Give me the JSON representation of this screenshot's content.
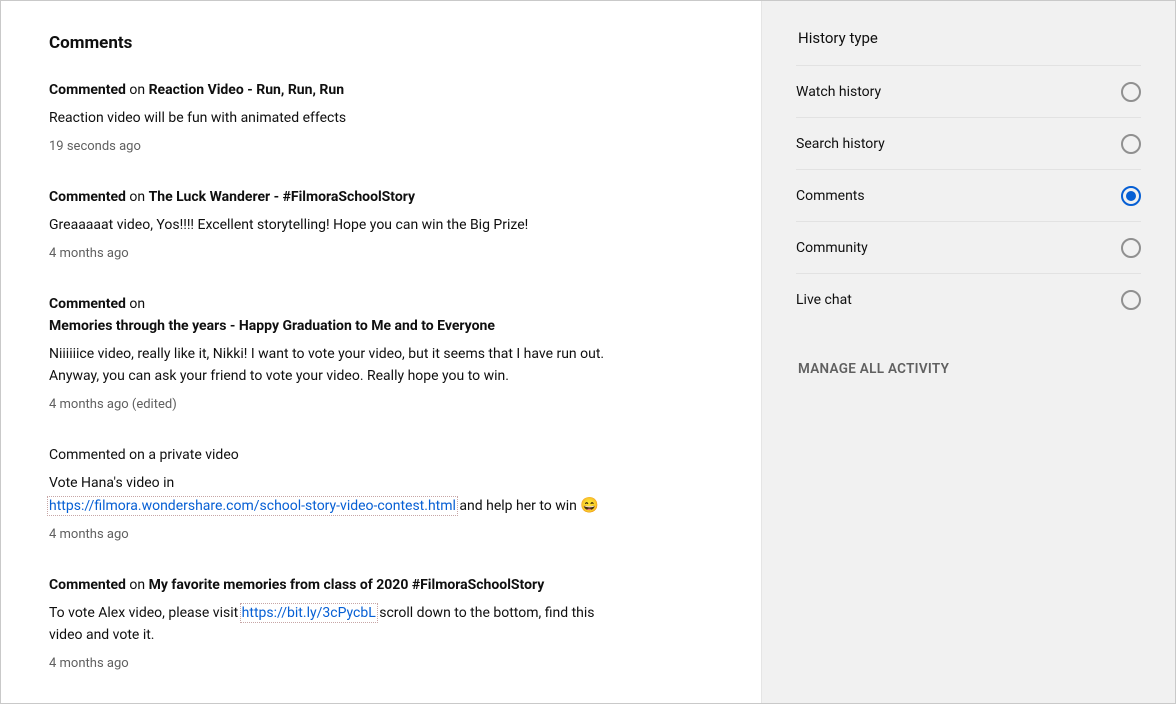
{
  "page_title": "Comments",
  "action_label": "Commented",
  "on_label": " on ",
  "comments": [
    {
      "prefix": "Commented",
      "video_title": "Reaction Video - Run, Run, Run",
      "body": "Reaction video will be fun with animated effects",
      "time": "19 seconds ago"
    },
    {
      "prefix": "Commented",
      "video_title": "The Luck Wanderer - #FilmoraSchoolStory",
      "body": "Greaaaaat video, Yos!!!! Excellent storytelling! Hope you can win the Big Prize!",
      "time": "4 months ago"
    },
    {
      "prefix": "Commented",
      "video_title": "Memories through the years - Happy Graduation to Me and to Everyone",
      "body_pre": "Niiiiiice video, really like it, ",
      "mention": "Nikki",
      "body_post": "! I want to vote your video, but it seems that I have run out. Anyway, you can ask your friend to vote your video. Really hope you to win.",
      "time": "4 months ago (edited)"
    },
    {
      "prefix": "Commented on a private video",
      "body_pre": "Vote Hana's video in ",
      "link": "https://filmora.wondershare.com/school-story-video-contest.html",
      "body_post": " and help her to win ",
      "emoji": "😄",
      "time": "4 months ago"
    },
    {
      "prefix": "Commented",
      "video_title": "My favorite memories from class of 2020 #FilmoraSchoolStory",
      "body_pre": "To vote Alex video, please visit ",
      "link": "https://bit.ly/3cPycbL",
      "body_post": " scroll down to the bottom, find this video and vote it.",
      "time": "4 months ago"
    }
  ],
  "sidebar": {
    "title": "History type",
    "options": [
      {
        "label": "Watch history",
        "selected": false
      },
      {
        "label": "Search history",
        "selected": false
      },
      {
        "label": "Comments",
        "selected": true
      },
      {
        "label": "Community",
        "selected": false
      },
      {
        "label": "Live chat",
        "selected": false
      }
    ],
    "manage": "MANAGE ALL ACTIVITY"
  }
}
